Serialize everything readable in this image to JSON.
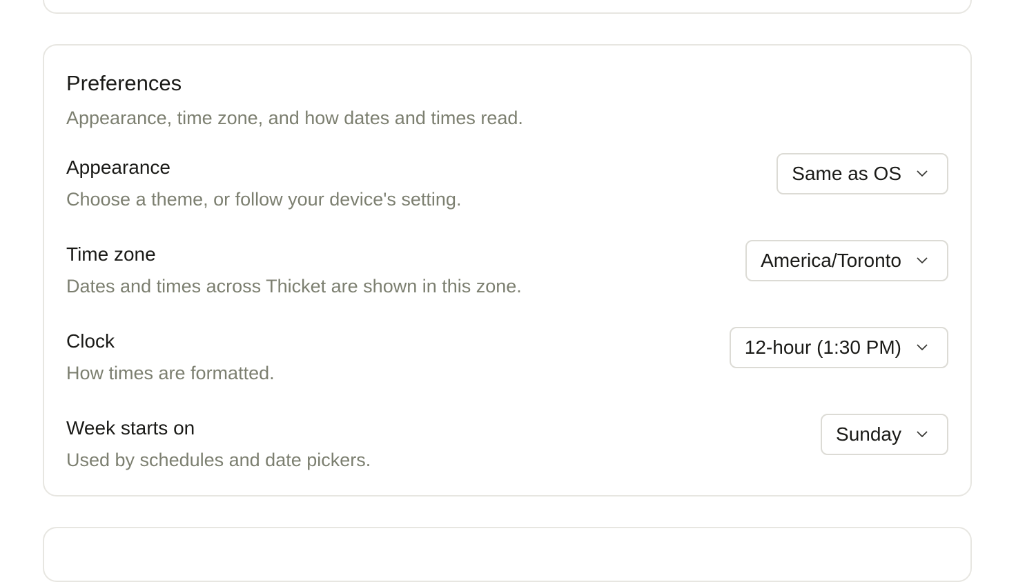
{
  "preferences": {
    "title": "Preferences",
    "description": "Appearance, time zone, and how dates and times read.",
    "settings": [
      {
        "label": "Appearance",
        "help": "Choose a theme, or follow your device's setting.",
        "value": "Same as OS",
        "icon": "chevron-down-icon"
      },
      {
        "label": "Time zone",
        "help": "Dates and times across Thicket are shown in this zone.",
        "value": "America/Toronto",
        "icon": "chevron-down-icon"
      },
      {
        "label": "Clock",
        "help": "How times are formatted.",
        "value": "12-hour (1:30 PM)",
        "icon": "chevron-down-icon"
      },
      {
        "label": "Week starts on",
        "help": "Used by schedules and date pickers.",
        "value": "Sunday",
        "icon": "chevron-down-icon"
      }
    ]
  },
  "colors": {
    "text_primary": "#1a1a17",
    "text_secondary": "#7c7f70",
    "border": "#e7e6e1"
  }
}
